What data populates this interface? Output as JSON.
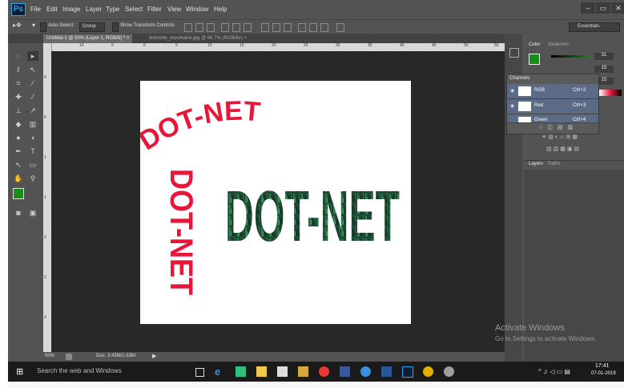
{
  "app": {
    "logo": "Ps"
  },
  "menu": [
    "File",
    "Edit",
    "Image",
    "Layer",
    "Type",
    "Select",
    "Filter",
    "View",
    "Window",
    "Help"
  ],
  "window_controls": {
    "minimize": "–",
    "restore": "▭",
    "close": "✕"
  },
  "options_bar": {
    "auto_select_label": "Auto-Select:",
    "auto_select_value": "Group",
    "show_transform_controls": "Show Transform Controls",
    "workspace": "Essentials"
  },
  "tabs": [
    {
      "label": "Untitled-1 @ 50% (Layer 1, RGB/8) *",
      "close": "×"
    },
    {
      "label": "dolomite_mountains.jpg @ 66.7% (RGB/8#)",
      "close": "×"
    }
  ],
  "ruler_h": [
    "10",
    "5",
    "0",
    "5",
    "10",
    "15",
    "20",
    "25",
    "30",
    "35",
    "40",
    "45",
    "50",
    "55"
  ],
  "ruler_v": [
    "0",
    "5",
    "1",
    "1",
    "2",
    "2",
    "3"
  ],
  "canvas_text": {
    "arched": "DOT-NET",
    "vertical": "DOT-NET",
    "textured": "DOT-NET"
  },
  "status": {
    "zoom": "50%",
    "doc": "Doc: 3.43M/1.63M",
    "arrow": "▶"
  },
  "panels": {
    "color_tab": "Color",
    "swatches_tab": "Swatches",
    "color_values": [
      "31",
      "15",
      "15"
    ],
    "channels_title": "Channels",
    "channels": [
      {
        "name": "RGB",
        "shortcut": "Ctrl+2"
      },
      {
        "name": "Red",
        "shortcut": "Ctrl+3"
      },
      {
        "name": "Green",
        "shortcut": "Ctrl+4"
      }
    ],
    "layers_tab": "Layers",
    "paths_tab": "Paths"
  },
  "watermark": {
    "title": "Activate Windows",
    "subtitle": "Go to Settings to activate Windows."
  },
  "taskbar": {
    "search_placeholder": "Search the web and Windows",
    "time": "17:41",
    "date": "07-01-2019",
    "tray": "^ ♫ ◁ ▭ ▤"
  },
  "colors": {
    "ps_blue": "#2fa3ef",
    "red_text": "#e8173a",
    "forest_text": "#1f5a3c",
    "foreground_swatch": "#1a8c1a"
  }
}
